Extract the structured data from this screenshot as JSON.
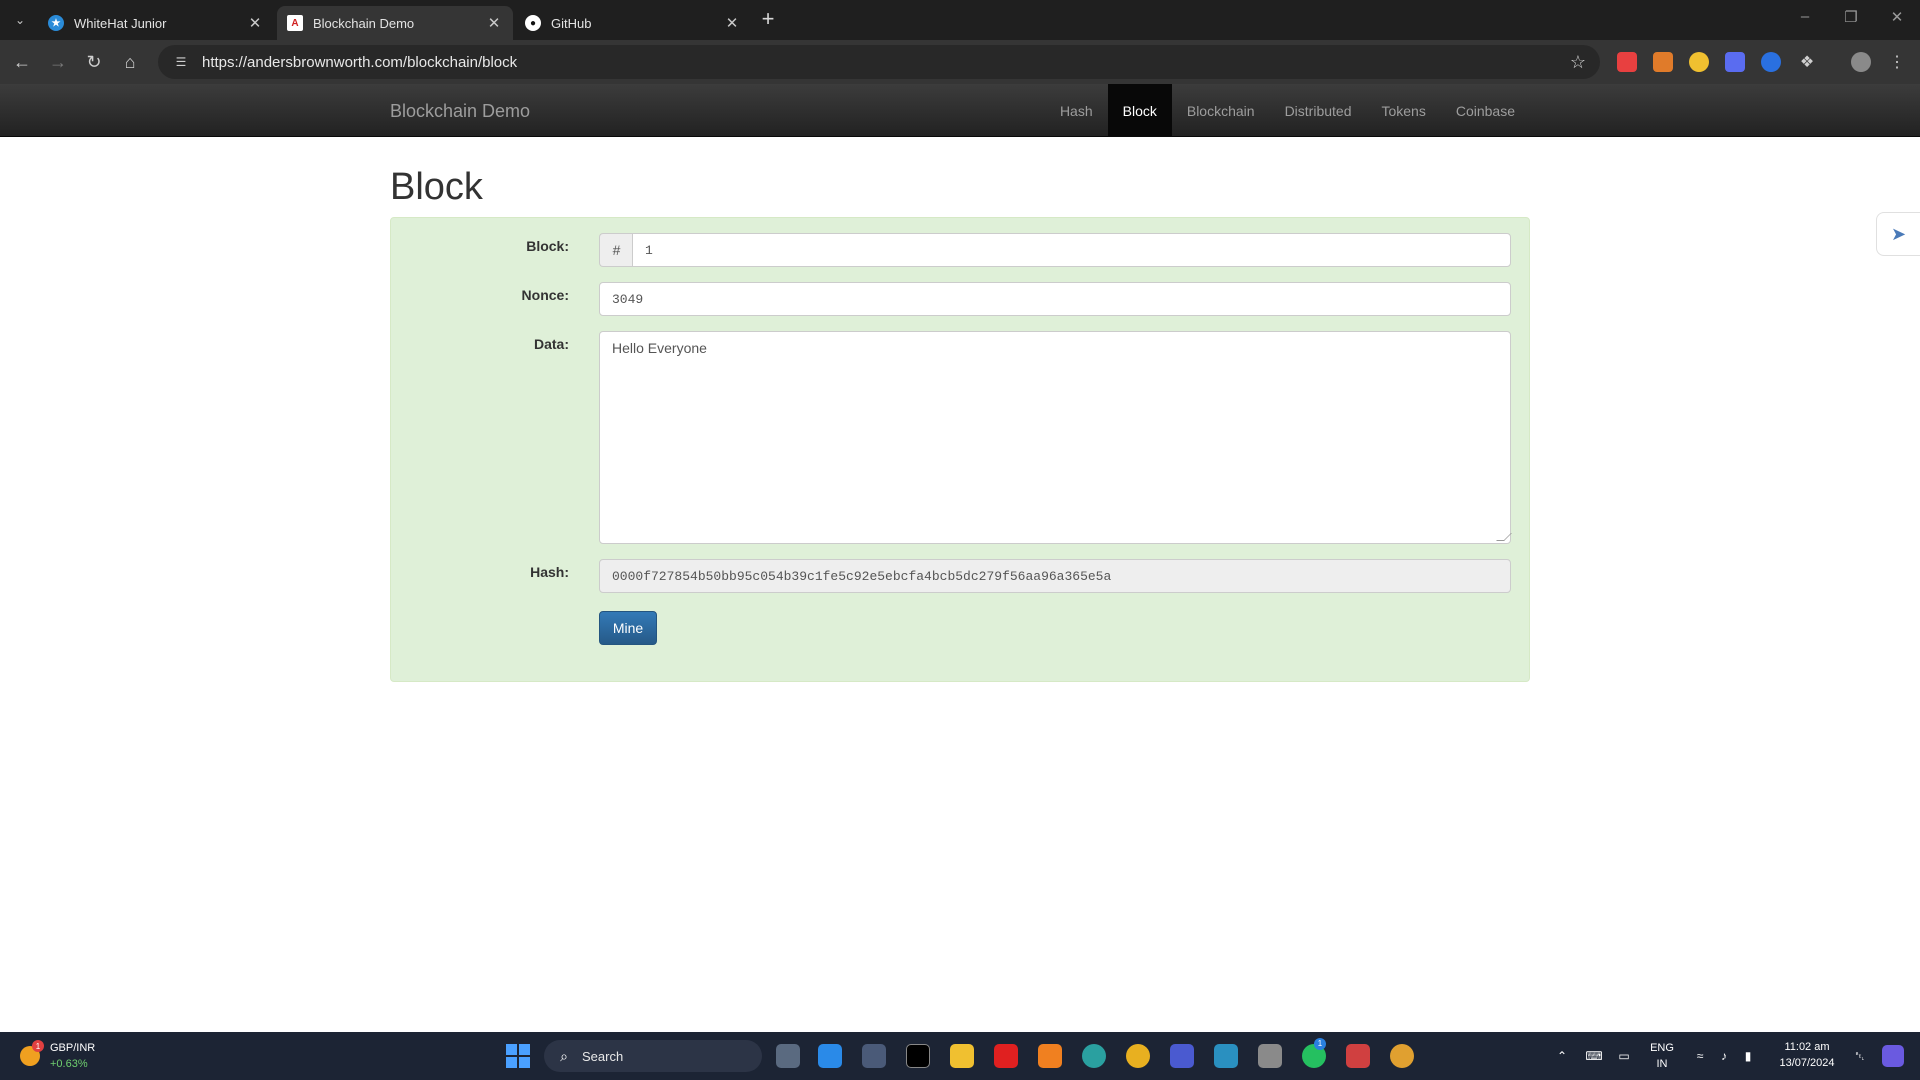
{
  "browser": {
    "tabs": [
      {
        "title": "WhiteHat Junior",
        "favicon": "whitehat-icon",
        "active": false
      },
      {
        "title": "Blockchain Demo",
        "favicon": "blockchain-demo-icon",
        "active": true
      },
      {
        "title": "GitHub",
        "favicon": "github-icon",
        "active": false
      }
    ],
    "url": "https://andersbrownworth.com/blockchain/block"
  },
  "site": {
    "brand": "Blockchain Demo",
    "nav": [
      {
        "label": "Hash",
        "active": false
      },
      {
        "label": "Block",
        "active": true
      },
      {
        "label": "Blockchain",
        "active": false
      },
      {
        "label": "Distributed",
        "active": false
      },
      {
        "label": "Tokens",
        "active": false
      },
      {
        "label": "Coinbase",
        "active": false
      }
    ]
  },
  "main": {
    "heading": "Block",
    "form": {
      "block_label": "Block:",
      "block_prefix": "#",
      "block_value": "1",
      "nonce_label": "Nonce:",
      "nonce_value": "3049",
      "data_label": "Data:",
      "data_value": "Hello Everyone",
      "hash_label": "Hash:",
      "hash_value": "0000f727854b50bb95c054b39c1fe5c92e5ebcfa4bcb5dc279f56aa96a365e5a",
      "mine_label": "Mine"
    },
    "colors": {
      "well_bg": "#dff0d8",
      "button": "#337ab7"
    }
  },
  "taskbar": {
    "ticker_symbol": "GBP/INR",
    "ticker_change": "+0.63%",
    "ticker_badge": "1",
    "search_label": "Search",
    "language": "ENG",
    "region": "IN",
    "time": "11:02 am",
    "date": "13/07/2024",
    "whatsapp_badge": "1"
  }
}
